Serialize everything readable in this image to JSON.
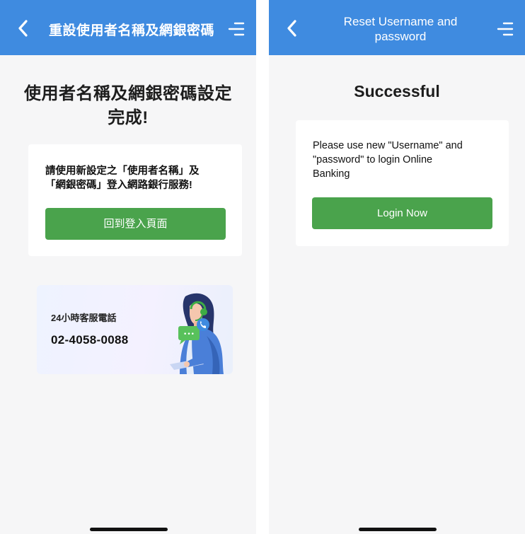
{
  "left_screen": {
    "header": {
      "title": "重設使用者名稱及網銀密碼"
    },
    "heading_line1": "使用者名稱及網銀密碼設定",
    "heading_line2": "完成!",
    "card": {
      "message_line1": "請使用新設定之「使用者名稱」及",
      "message_line2": "「網銀密碼」登入網路銀行服務!",
      "button_label": "回到登入頁面"
    },
    "support_banner": {
      "label": "24小時客服電話",
      "phone": "02-4058-0088",
      "chat_bubble_text": "•••"
    }
  },
  "right_screen": {
    "header": {
      "title_line1": "Reset Username and",
      "title_line2": "password"
    },
    "heading": "Successful",
    "card": {
      "message_line1": "Please use new \"Username\" and",
      "message_line2": "\"password\" to login Online",
      "message_line3": "Banking",
      "button_label": "Login Now"
    }
  },
  "colors": {
    "header_blue": "#3f8be0",
    "button_green": "#4aa34c",
    "background": "#f6f6f7"
  },
  "icons": [
    "chevron-left-icon",
    "menu-icon",
    "headset-agent-illustration",
    "chat-bubble-icon",
    "phone-icon"
  ]
}
